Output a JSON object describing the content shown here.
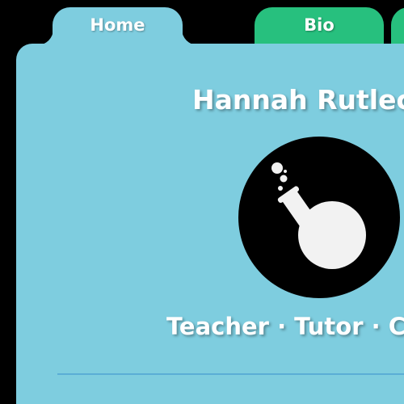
{
  "tabs": [
    {
      "label": "Home",
      "color": "#7ecddf"
    },
    {
      "label": "Bio",
      "color": "#27c07e"
    }
  ],
  "profile": {
    "name": "Hannah Rutlec",
    "tagline": "Teacher · Tutor · Ch",
    "logo_icon": "flask-icon"
  },
  "colors": {
    "background": "#000000",
    "card": "#7ecddf",
    "accent_green": "#27c07e",
    "divider": "#5aaed6"
  }
}
